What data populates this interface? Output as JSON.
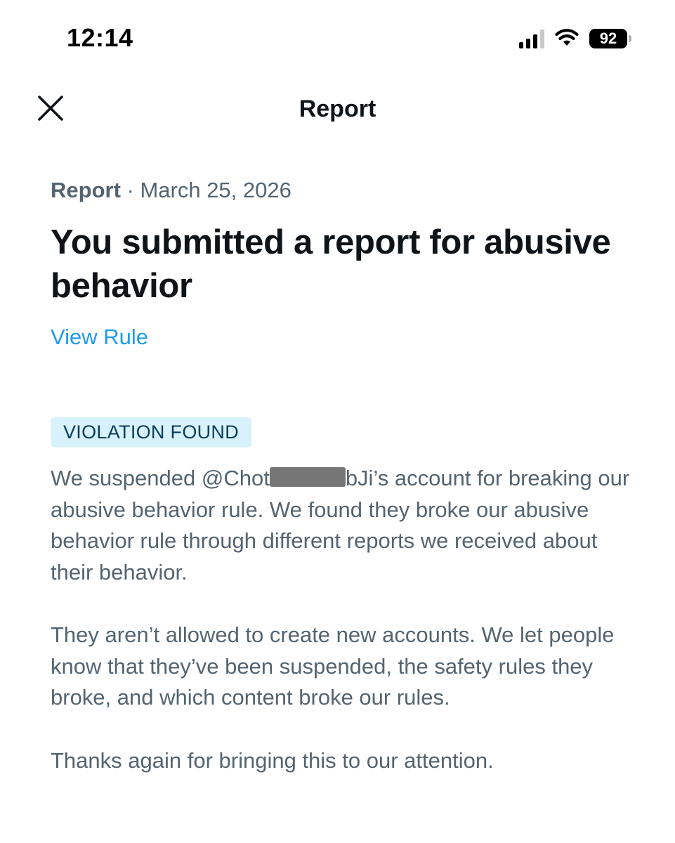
{
  "status_bar": {
    "time": "12:14",
    "battery_level": "92",
    "signal_bars": 3,
    "icons": [
      "signal-icon",
      "wifi-icon",
      "battery-icon"
    ]
  },
  "header": {
    "title": "Report",
    "close_icon": "close-icon"
  },
  "report": {
    "type_label": "Report",
    "separator": " · ",
    "date": "March 25, 2026",
    "headline": "You submitted a report for abusive behavior",
    "view_rule_label": "View Rule",
    "badge": "VIOLATION FOUND",
    "p1_prefix": "We suspended @Chot",
    "p1_suffix": "bJi’s account for breaking our abusive behavior rule. We found they broke our abusive behavior rule through different reports we received about their behavior.",
    "p2": "They aren’t allowed to create new accounts. We let people know that they’ve been suspended, the safety rules they broke, and which content broke our rules.",
    "p3": "Thanks again for bringing this to our attention."
  },
  "colors": {
    "text_primary": "#0f1419",
    "text_secondary": "#536471",
    "link": "#1d9bf0",
    "badge_bg": "#d8f2fb",
    "badge_text": "#0b3d5c"
  }
}
